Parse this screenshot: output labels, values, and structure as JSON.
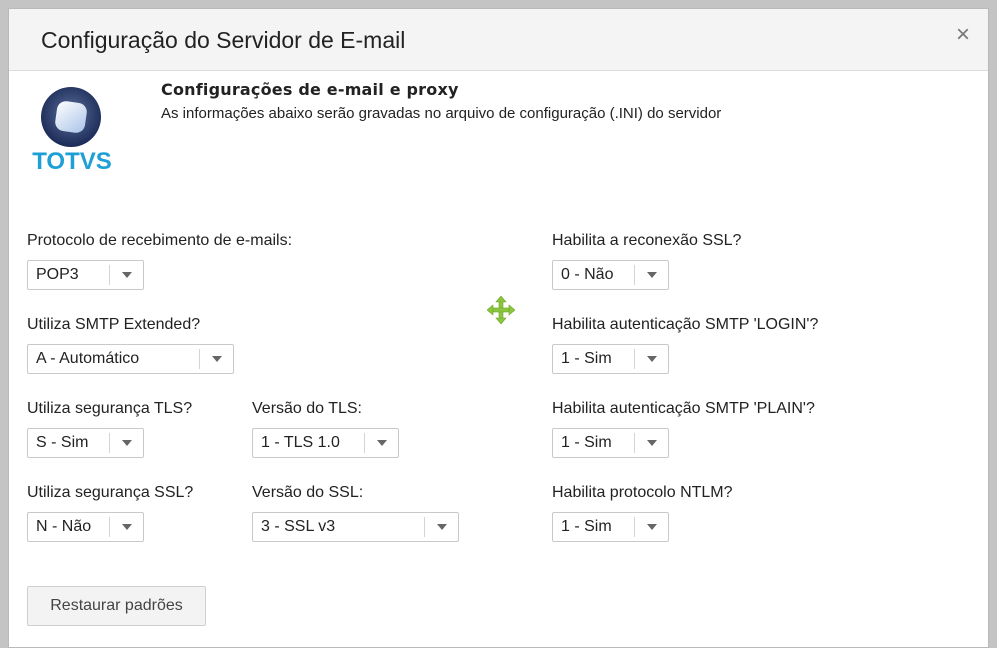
{
  "dialog": {
    "title": "Configuração do Servidor de E-mail",
    "close_glyph": "×"
  },
  "header": {
    "logo_icon": "totvs-logo",
    "logo_text": "TOTVS",
    "title": "Configurações de e-mail e proxy",
    "subtitle": "As informações abaixo serão gravadas no arquivo de configuração (.INI) do servidor"
  },
  "fields": {
    "receive_protocol": {
      "label": "Protocolo de recebimento de e-mails:",
      "value": "POP3"
    },
    "smtp_extended": {
      "label": "Utiliza SMTP Extended?",
      "value": "A - Automático"
    },
    "tls_security": {
      "label": "Utiliza segurança TLS?",
      "value": "S - Sim"
    },
    "tls_version": {
      "label": "Versão do TLS:",
      "value": "1 - TLS 1.0"
    },
    "ssl_security": {
      "label": "Utiliza segurança SSL?",
      "value": "N - Não"
    },
    "ssl_version": {
      "label": "Versão do SSL:",
      "value": "3 - SSL v3"
    },
    "ssl_reconnect": {
      "label": "Habilita a reconexão SSL?",
      "value": "0 - Não"
    },
    "smtp_login_auth": {
      "label": "Habilita autenticação SMTP 'LOGIN'?",
      "value": "1 - Sim"
    },
    "smtp_plain_auth": {
      "label": "Habilita autenticação SMTP 'PLAIN'?",
      "value": "1 - Sim"
    },
    "ntlm_protocol": {
      "label": "Habilita protocolo NTLM?",
      "value": "1 - Sim"
    }
  },
  "actions": {
    "restore_defaults": "Restaurar padrões"
  },
  "icons": {
    "move": "move-cursor-icon",
    "dropdown": "chevron-down-icon"
  },
  "colors": {
    "logo_text": "#1e9fd6",
    "move_icon": "#8cc63f"
  }
}
